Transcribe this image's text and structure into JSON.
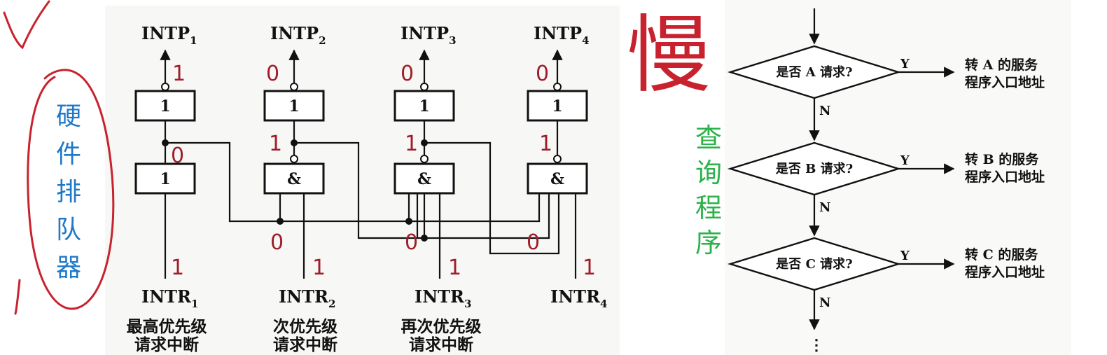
{
  "circuit": {
    "outputs": [
      {
        "name": "INTP",
        "sub": "1",
        "bit": "1"
      },
      {
        "name": "INTP",
        "sub": "2",
        "bit": "0"
      },
      {
        "name": "INTP",
        "sub": "3",
        "bit": "0"
      },
      {
        "name": "INTP",
        "sub": "4",
        "bit": "0"
      }
    ],
    "top_gates": [
      "1",
      "1",
      "1",
      "1"
    ],
    "bottom_gates": [
      "1",
      "&",
      "&",
      "&"
    ],
    "mid_bits": [
      "0",
      "1",
      "1",
      "1"
    ],
    "bus_bits": [
      "0",
      "0",
      "0"
    ],
    "inputs": [
      {
        "name": "INTR",
        "sub": "1",
        "bit": "1",
        "desc1": "最高优先级",
        "desc2": "请求中断"
      },
      {
        "name": "INTR",
        "sub": "2",
        "bit": "1",
        "desc1": "次优先级",
        "desc2": "请求中断"
      },
      {
        "name": "INTR",
        "sub": "3",
        "bit": "1",
        "desc1": "再次优先级",
        "desc2": "请求中断"
      },
      {
        "name": "INTR",
        "sub": "4",
        "bit": "1",
        "desc1": "",
        "desc2": ""
      }
    ]
  },
  "annotations": {
    "hardware_label": "硬件排队器",
    "query_label": "查询程序",
    "handwriting": "慢",
    "colors": {
      "hardware": "#1f78c8",
      "query": "#2bb24a",
      "ink": "#c8222e",
      "bits": "#a01e2a"
    }
  },
  "flowchart": {
    "decisions": [
      {
        "text": "是否 A 请求?",
        "yes": "Y",
        "no": "N",
        "target1": "转 A 的服务",
        "target2": "程序入口地址"
      },
      {
        "text": "是否 B 请求?",
        "yes": "Y",
        "no": "N",
        "target1": "转 B 的服务",
        "target2": "程序入口地址"
      },
      {
        "text": "是否 C 请求?",
        "yes": "Y",
        "no": "N",
        "target1": "转 C 的服务",
        "target2": "程序入口地址"
      }
    ],
    "continuation": "⋮"
  }
}
